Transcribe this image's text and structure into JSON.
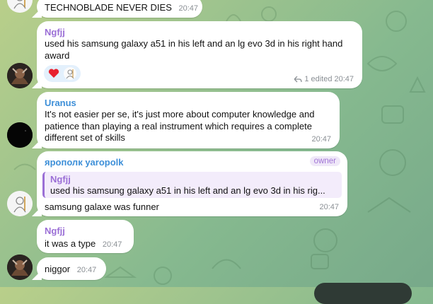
{
  "colors": {
    "purple_author": "#9b6fd6",
    "blue_author": "#3d8fd8",
    "time_gray": "#8a8f94",
    "owner_badge_text": "#a175d6",
    "reaction_bg": "#e3f0fc"
  },
  "messages": [
    {
      "id": "m1",
      "text": "TECHNOBLADE NEVER DIES",
      "time": "20:47",
      "avatar_icon": "sketch-avatar-icon"
    },
    {
      "id": "m2",
      "author": "Ngfjj",
      "text": "used his samsung galaxy a51 in his left and an lg evo 3d in his right hand award",
      "reactions": [
        "heart-emoji-icon",
        "sticker-avatar-icon"
      ],
      "edited_label": "1 edited",
      "time": "20:47",
      "avatar_icon": "dark-avatar-icon"
    },
    {
      "id": "m3",
      "author": "Uranus",
      "text": "It's not easier per se, it's just more about computer knowledge and patience than playing a real instrument which requires a complete different set of skills",
      "time": "20:47",
      "avatar_icon": "black-avatar-icon"
    },
    {
      "id": "m4",
      "author": "ярополк yaropolk",
      "badge": "owner",
      "reply_author": "Ngfjj",
      "reply_text": "used his samsung galaxy a51 in his left and an lg evo 3d in his rig...",
      "text": "samsung galaxe was funner",
      "time": "20:47",
      "avatar_icon": "sketch-avatar-icon"
    },
    {
      "id": "m5",
      "author": "Ngfjj",
      "text": "it was a type",
      "time": "20:47"
    },
    {
      "id": "m6",
      "text": "niggor",
      "time": "20:47",
      "avatar_icon": "dark-avatar-icon"
    }
  ]
}
